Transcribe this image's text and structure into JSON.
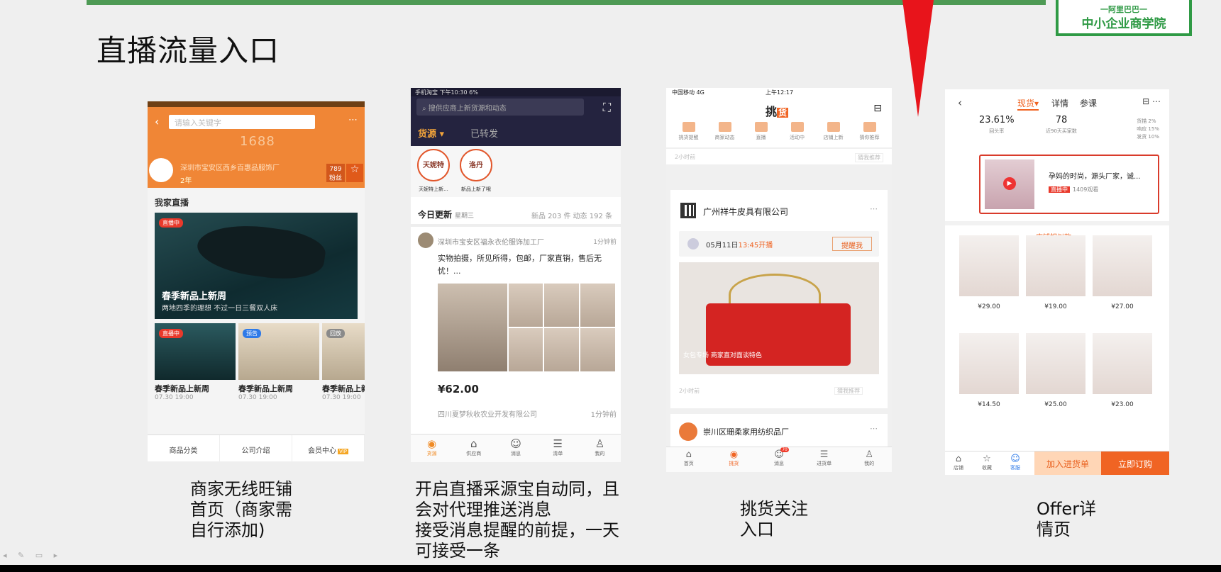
{
  "slide": {
    "title": "直播流量入口",
    "logo_top": "一阿里巴巴一",
    "logo_text": "中小企业商学院",
    "captions": [
      "商家无线旺铺\n首页（商家需\n自行添加)",
      "开启直播采源宝自动同，且\n会对代理推送消息\n接受消息提醒的前提，一天\n可接受一条",
      "挑货关注\n入口",
      "Offer详\n情页"
    ],
    "accent_color": "#4e9a55"
  },
  "phone1": {
    "search_placeholder": "请输入关键字",
    "brand": "1688",
    "shop_name": "深圳市宝安区西乡百惠品服饰厂",
    "years": "2年",
    "stat_num": "789",
    "stat_label": "粉丝",
    "fav_label": "关注",
    "section": "我家直播",
    "live_badge": "直播中",
    "hero_title": "春季新品上新周",
    "hero_sub": "两地四季的理想 不过一日三餐双人床",
    "thumbs": [
      {
        "badge": "直播中",
        "label": "春季新品上新周",
        "time": "07.30 19:00"
      },
      {
        "badge": "预告",
        "label": "春季新品上新周",
        "time": "07.30 19:00"
      },
      {
        "badge": "回放",
        "label": "春季新品上新周",
        "time": "07.30 19:00"
      }
    ],
    "tabs": [
      "商品分类",
      "公司介绍",
      "会员中心"
    ],
    "vip": "VIP"
  },
  "phone2": {
    "status": "手机淘宝 下午10:30 6%",
    "search_placeholder": "搜供应商上新货源和动态",
    "tab_active": "货源",
    "tab_other": "已转发",
    "stories": [
      {
        "logo": "天妮特",
        "label": "天妮特上新..."
      },
      {
        "logo": "洛丹",
        "label": "新品上新了哦"
      }
    ],
    "today": "今日更新",
    "weekday": "星期三",
    "counts": "新品 203 件  动态 192 条",
    "post_shop": "深圳市宝安区福永衣伦服饰加工厂",
    "post_time": "1分钟前",
    "post_text": "实物拍摄，所见所得，包邮，厂家直销，售后无忧！...",
    "price": "¥62.00",
    "post2_shop": "四川夏梦秋收农业开发有限公司",
    "post2_time": "1分钟前",
    "nav": [
      "货源",
      "供应商",
      "消息",
      "清单",
      "我的"
    ]
  },
  "phone3": {
    "status": "中国移动 4G",
    "time": "上午12:17",
    "logo": "挑",
    "logo_mark": "货",
    "cats": [
      "挑货提醒",
      "商家动态",
      "直播",
      "活动中",
      "店铺上新",
      "猜你推荐"
    ],
    "ago": "2小时前",
    "ago_tag": "猜我推荐",
    "company": "广州祥牛皮具有限公司",
    "live_date": "05月11日",
    "live_time": "13:45开播",
    "remind": "提醒我",
    "overlay": "女包专场 商家直对面谈特色",
    "company2": "崇川区珊柔家用纺织品厂",
    "nav": [
      "首页",
      "挑货",
      "消息",
      "进货单",
      "我的"
    ],
    "msg_count": "70"
  },
  "phone4": {
    "tabs": [
      "现货",
      "详情",
      "参课"
    ],
    "stat1_val": "23.61%",
    "stat1_lbl": "回头率",
    "stat2_val": "78",
    "stat2_lbl": "近90天买家数",
    "mini1": "货描 2%",
    "mini2": "响应 15%",
    "mini3": "发货 10%",
    "live_text": "孕妈的时尚，源头厂家，诚...",
    "live_badge": "直播中",
    "viewers": "1409观看",
    "similar": "店铺相似款",
    "prices": [
      "¥29.00",
      "¥19.00",
      "¥27.00",
      "¥14.50",
      "¥25.00",
      "¥23.00"
    ],
    "nav_icons": [
      "店铺",
      "收藏",
      "客服"
    ],
    "cart": "加入进货单",
    "buy": "立即订购"
  }
}
